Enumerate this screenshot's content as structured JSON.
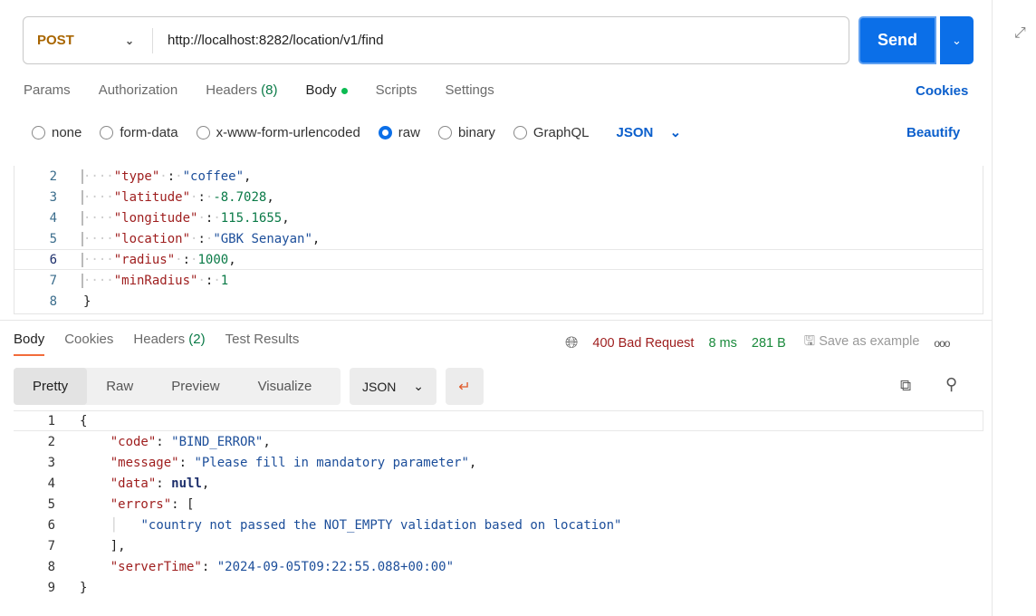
{
  "request": {
    "method": "POST",
    "url": "http://localhost:8282/location/v1/find",
    "send_label": "Send"
  },
  "tabs": [
    {
      "label": "Params"
    },
    {
      "label": "Authorization"
    },
    {
      "label": "Headers",
      "count": "(8)"
    },
    {
      "label": "Body"
    },
    {
      "label": "Scripts"
    },
    {
      "label": "Settings"
    }
  ],
  "cookies_label": "Cookies",
  "body_types": [
    {
      "label": "none",
      "checked": false
    },
    {
      "label": "form-data",
      "checked": false
    },
    {
      "label": "x-www-form-urlencoded",
      "checked": false
    },
    {
      "label": "raw",
      "checked": true
    },
    {
      "label": "binary",
      "checked": false
    },
    {
      "label": "GraphQL",
      "checked": false
    }
  ],
  "body_format": "JSON",
  "beautify_label": "Beautify",
  "request_body": [
    {
      "n": "2",
      "k": "\"type\"",
      "v": "\"coffee\"",
      "t": "s",
      "c": ","
    },
    {
      "n": "3",
      "k": "\"latitude\"",
      "v": "-8.7028",
      "t": "n",
      "c": ","
    },
    {
      "n": "4",
      "k": "\"longitude\"",
      "v": "115.1655",
      "t": "n",
      "c": ","
    },
    {
      "n": "5",
      "k": "\"location\"",
      "v": "\"GBK Senayan\"",
      "t": "s",
      "c": ","
    },
    {
      "n": "6",
      "k": "\"radius\"",
      "v": "1000",
      "t": "n",
      "c": ","
    },
    {
      "n": "7",
      "k": "\"minRadius\"",
      "v": "1",
      "t": "n",
      "c": ""
    },
    {
      "n": "8",
      "raw": "}"
    }
  ],
  "response_tabs": [
    {
      "label": "Body"
    },
    {
      "label": "Cookies"
    },
    {
      "label": "Headers",
      "count": "(2)"
    },
    {
      "label": "Test Results"
    }
  ],
  "response_status": {
    "status": "400 Bad Request",
    "time": "8 ms",
    "size": "281 B",
    "save_label": "Save as example"
  },
  "view_modes": [
    "Pretty",
    "Raw",
    "Preview",
    "Visualize"
  ],
  "response_format": "JSON",
  "response_lines": [
    "1",
    "2",
    "3",
    "4",
    "5",
    "6",
    "7",
    "8",
    "9"
  ],
  "response_body": {
    "code": "BIND_ERROR",
    "message": "Please fill in mandatory parameter",
    "data": "null",
    "error": "country not passed the NOT_EMPTY validation based on location",
    "serverTime": "2024-09-05T09:22:55.088+00:00"
  },
  "colors": {
    "accent": "#0b6fe8",
    "status_error": "#9e1d1d",
    "status_ok": "#1a8a3c"
  }
}
